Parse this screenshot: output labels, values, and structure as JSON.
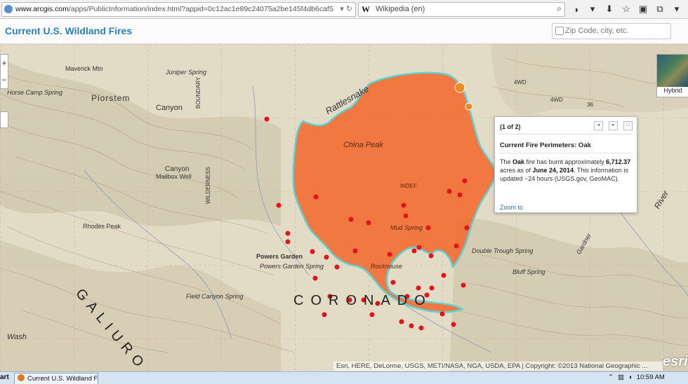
{
  "browser": {
    "url_host": "www.arcgis.com",
    "url_path": "/apps/PublicInformation/index.html?appid=0c12ac1e89c24075a2be145f4db6caf5",
    "search_engine_label": "Wikipedia (en)"
  },
  "app": {
    "title": "Current U.S. Wildland Fires",
    "search_placeholder": "Zip Code, city, etc."
  },
  "map": {
    "place_labels": [
      "Maverick Mtn",
      "Piorstem",
      "Canyon",
      "Canyon",
      "Juniper Spring",
      "Horse Camp Spring",
      "BOUNDARY",
      "Rattlesnake",
      "Mailbox Well",
      "WILDERNESS",
      "Rhodes Peak",
      "China Peak",
      "INDEF",
      "Powers Garden",
      "Powers Garden Spring",
      "Mud Spring",
      "Rocknouse",
      "Double Trough Spring",
      "Bluff Spring",
      "CORONADO",
      "GALIURO",
      "Field Canyon Spring",
      "Wash",
      "Gardner",
      "River",
      "4WD",
      "4WD",
      "36"
    ],
    "basemap_label": "Hybrid",
    "attribution": "Esri, HERE, DeLorme, USGS, METI/NASA, NGA, USDA, EPA | Copyright: ©2013 National Geographic ...",
    "logo": "esri"
  },
  "popup": {
    "count": "(1 of 2)",
    "title": "Current Fire Perimeters: Oak",
    "text_1": "The ",
    "fire_name": "Oak",
    "text_2": " fire has burnt approximately ",
    "acres": "6,712.37",
    "text_3": " acres as of ",
    "date": "June 24, 2014",
    "text_4": ". This information is updated ~24 hours (USGS.gov, GeoMAC).",
    "zoom_link": "Zoom to"
  },
  "taskbar": {
    "start_label": "art",
    "task_label": "Current U.S. Wildland F...",
    "clock": "10:59 AM"
  },
  "colors": {
    "fire_fill": "#f36a2f",
    "fire_outline": "#5fd0d3",
    "hotspot": "#e3141c",
    "title_blue": "#2a7fbd"
  }
}
